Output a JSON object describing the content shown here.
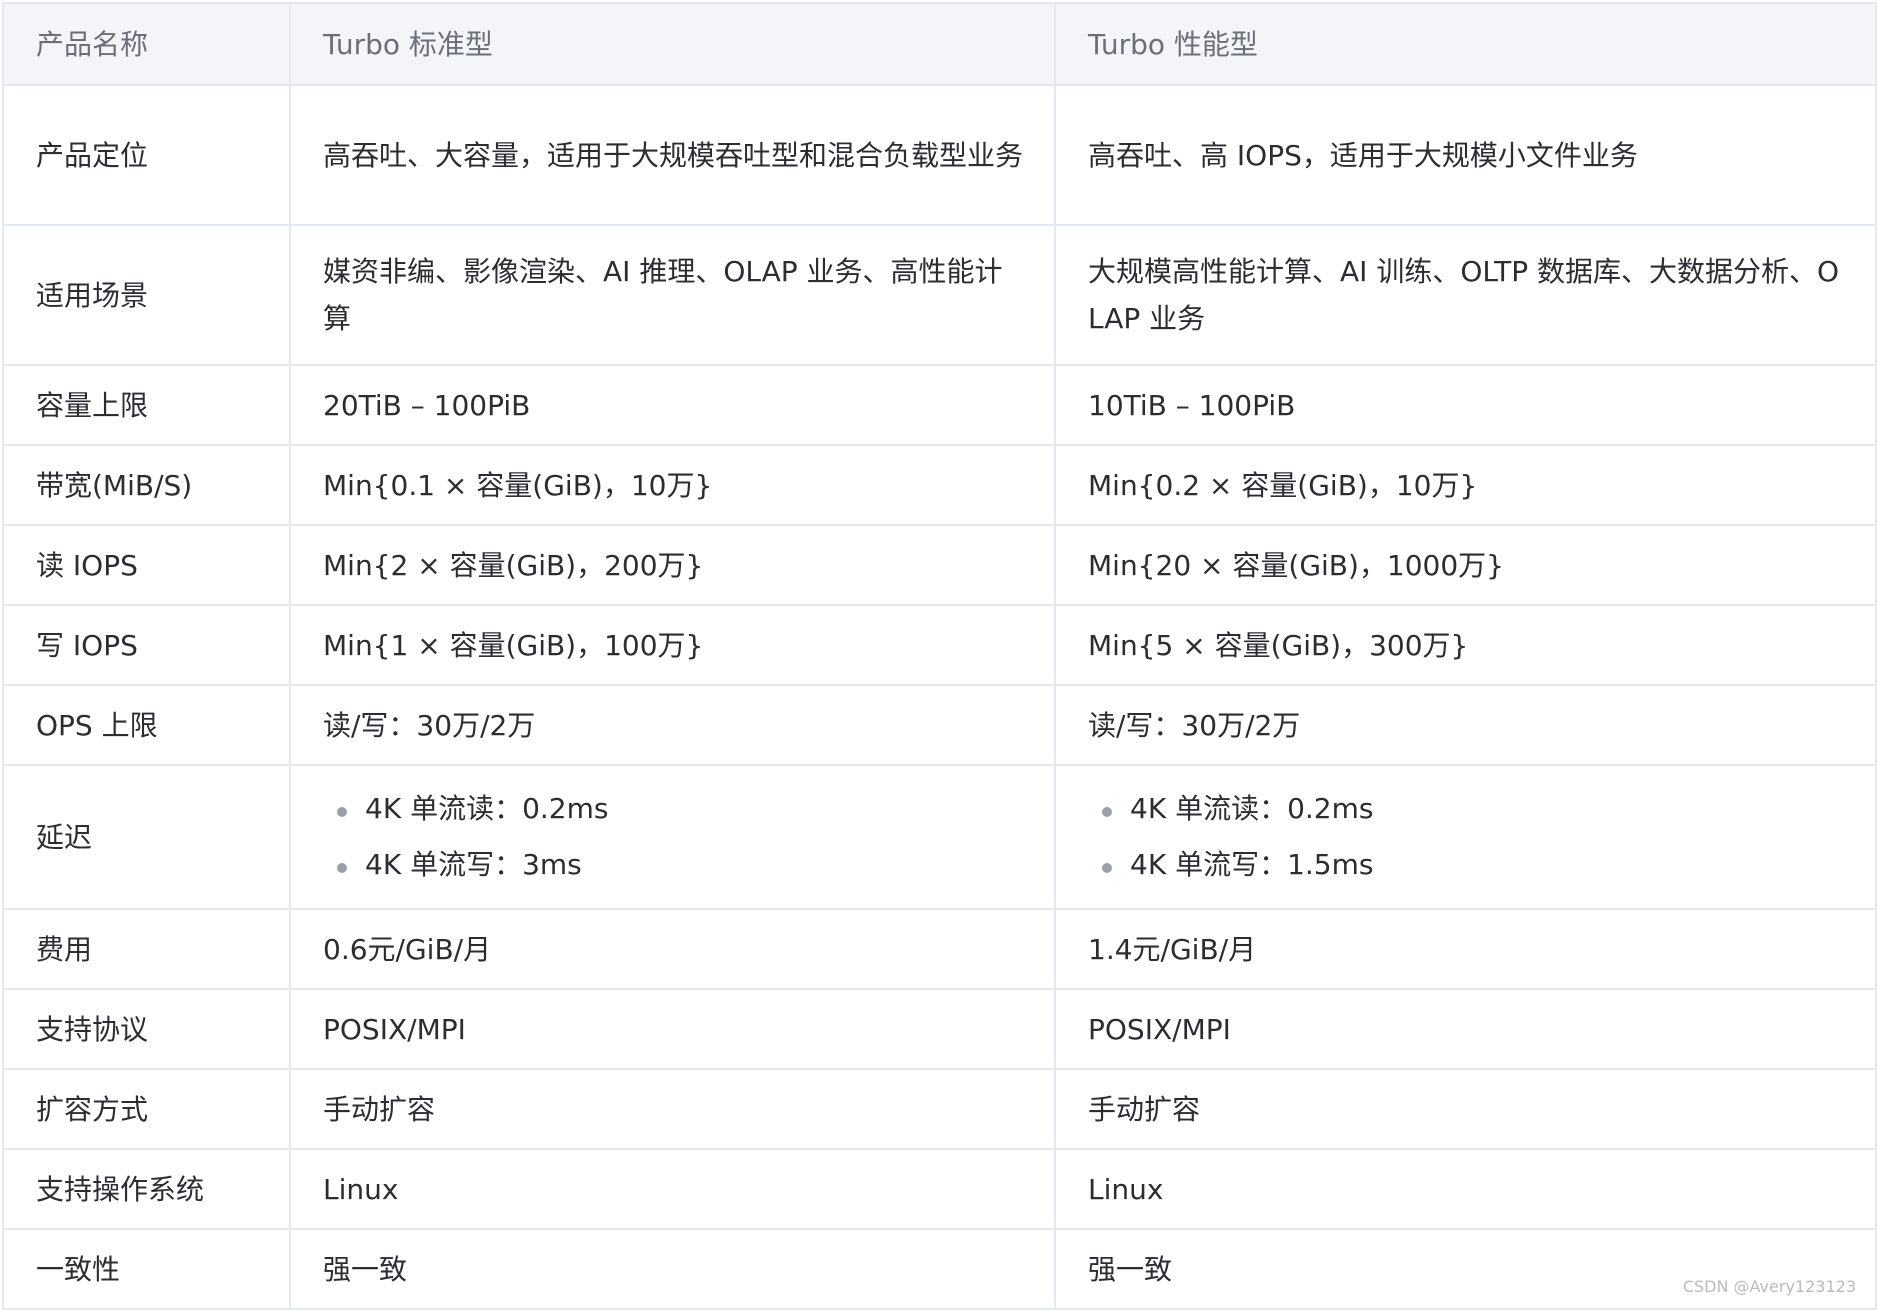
{
  "table": {
    "headers": [
      "产品名称",
      "Turbo 标准型",
      "Turbo 性能型"
    ],
    "rows": [
      {
        "label": "产品定位",
        "standard": "高吞吐、大容量，适用于大规模吞吐型和混合负载型业务",
        "performance": "高吞吐、高 IOPS，适用于大规模小文件业务"
      },
      {
        "label": "适用场景",
        "standard": "媒资非编、影像渲染、AI 推理、OLAP 业务、高性能计算",
        "performance": "大规模高性能计算、AI 训练、OLTP 数据库、大数据分析、OLAP 业务"
      },
      {
        "label": "容量上限",
        "standard": "20TiB – 100PiB",
        "performance": "10TiB – 100PiB"
      },
      {
        "label": "带宽(MiB/S)",
        "standard": "Min{0.1 × 容量(GiB)，10万}",
        "performance": "Min{0.2 × 容量(GiB)，10万}"
      },
      {
        "label": "读 IOPS",
        "standard": "Min{2 × 容量(GiB)，200万}",
        "performance": "Min{20 × 容量(GiB)，1000万}"
      },
      {
        "label": "写 IOPS",
        "standard": "Min{1 × 容量(GiB)，100万}",
        "performance": "Min{5 × 容量(GiB)，300万}"
      },
      {
        "label": "OPS 上限",
        "standard": "读/写：30万/2万",
        "performance": "读/写：30万/2万"
      },
      {
        "label": "延迟",
        "standard": [
          "4K 单流读：0.2ms",
          "4K 单流写：3ms"
        ],
        "performance": [
          "4K 单流读：0.2ms",
          "4K 单流写：1.5ms"
        ]
      },
      {
        "label": "费用",
        "standard": "0.6元/GiB/月",
        "performance": "1.4元/GiB/月"
      },
      {
        "label": "支持协议",
        "standard": "POSIX/MPI",
        "performance": "POSIX/MPI"
      },
      {
        "label": "扩容方式",
        "standard": "手动扩容",
        "performance": "手动扩容"
      },
      {
        "label": "支持操作系统",
        "standard": "Linux",
        "performance": "Linux"
      },
      {
        "label": "一致性",
        "standard": "强一致",
        "performance": "强一致"
      }
    ]
  },
  "watermark": "CSDN @Avery123123",
  "colors": {
    "header_bg": "#f3f5f8",
    "border": "#e5e8ee",
    "text": "#2b2d33",
    "header_text": "#6b6f79",
    "bullet": "#9aa0ab"
  }
}
